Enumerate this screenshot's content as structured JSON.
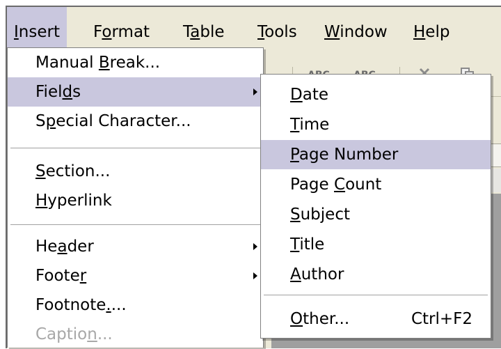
{
  "menubar": {
    "items": [
      "Insert",
      "Format",
      "Table",
      "Tools",
      "Window",
      "Help"
    ],
    "mnemonics": [
      "I",
      "o",
      "a",
      "T",
      "W",
      "H"
    ],
    "active": "Insert"
  },
  "toolbar": {
    "spellcheck_glyph": "ABC",
    "autospell_glyph": "ABC",
    "cut_icon": "scissors-icon",
    "copy_icon": "copy-icon"
  },
  "insert_menu": {
    "items": [
      {
        "label": "Manual Break...",
        "pre": "Manual ",
        "key": "B",
        "post": "reak..."
      },
      {
        "label": "Fields",
        "pre": "Fiel",
        "key": "d",
        "post": "s",
        "submenu": true,
        "highlighted": true
      },
      {
        "label": "Special Character...",
        "pre": "S",
        "key": "p",
        "post": "ecial Character..."
      },
      {
        "label": "Section...",
        "pre": "",
        "key": "S",
        "post": "ection..."
      },
      {
        "label": "Hyperlink",
        "pre": "",
        "key": "H",
        "post": "yperlink"
      },
      {
        "label": "Header",
        "pre": "He",
        "key": "a",
        "post": "der",
        "submenu": true
      },
      {
        "label": "Footer",
        "pre": "Foote",
        "key": "r",
        "post": "",
        "submenu": true
      },
      {
        "label": "Footnote...",
        "pre": "Footnote",
        "key": ".",
        "post": "..."
      },
      {
        "label": "Caption...",
        "pre": "Captio",
        "key": "n",
        "post": "...",
        "disabled": true
      }
    ]
  },
  "fields_menu": {
    "items": [
      {
        "label": "Date",
        "pre": "",
        "key": "D",
        "post": "ate"
      },
      {
        "label": "Time",
        "pre": "",
        "key": "T",
        "post": "ime"
      },
      {
        "label": "Page Number",
        "pre": "",
        "key": "P",
        "post": "age Number",
        "highlighted": true
      },
      {
        "label": "Page Count",
        "pre": "Page ",
        "key": "C",
        "post": "ount"
      },
      {
        "label": "Subject",
        "pre": "",
        "key": "S",
        "post": "ubject"
      },
      {
        "label": "Title",
        "pre": "",
        "key": "T",
        "post": "itle"
      },
      {
        "label": "Author",
        "pre": "",
        "key": "A",
        "post": "uthor"
      },
      {
        "label": "Other...",
        "pre": "",
        "key": "O",
        "post": "ther...",
        "shortcut": "Ctrl+F2"
      }
    ]
  },
  "colors": {
    "highlight": "#c9c7de",
    "chrome": "#ece9d8",
    "disabled_text": "#a8a8a8"
  }
}
